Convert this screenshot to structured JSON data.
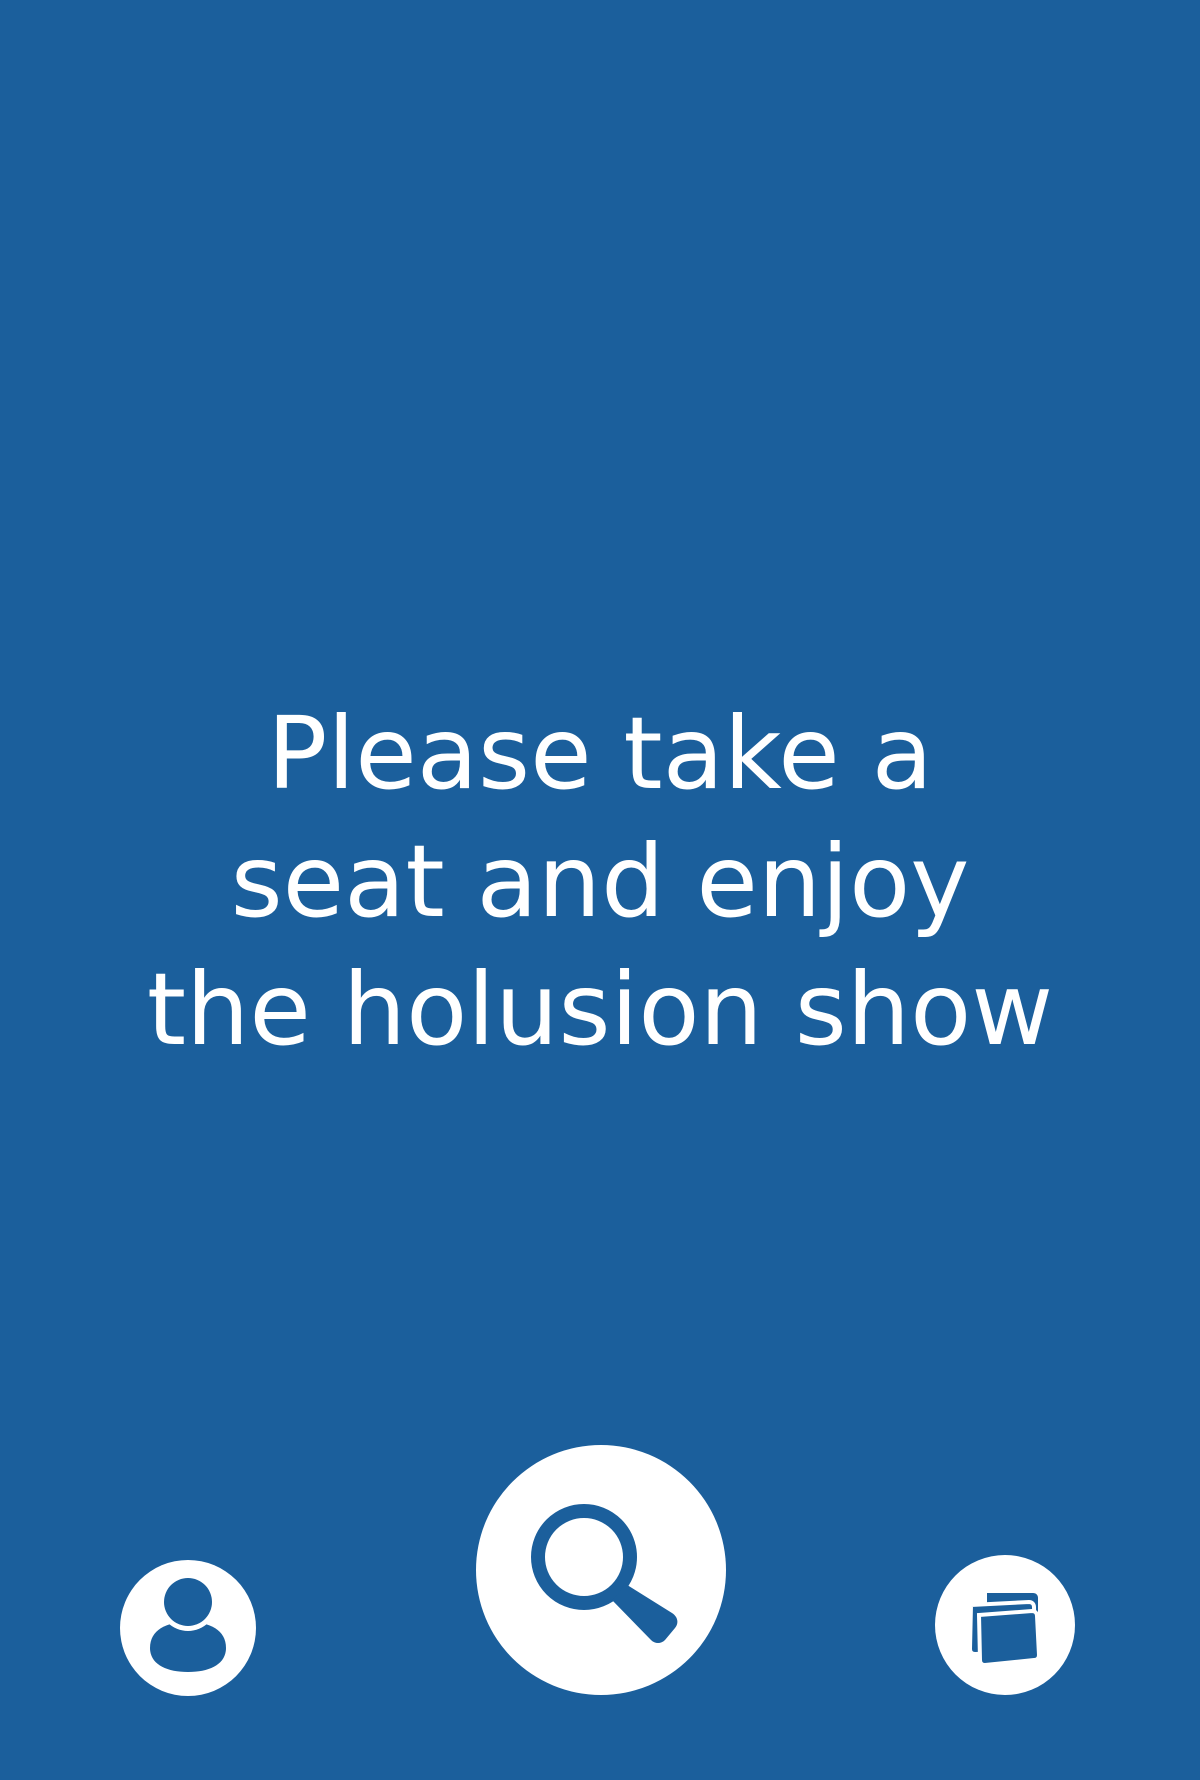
{
  "message": {
    "lines": [
      "Please take a",
      "seat and enjoy",
      "the holusion show"
    ]
  },
  "controls": {
    "profile": {
      "icon": "user-icon"
    },
    "search": {
      "icon": "magnifier-icon"
    },
    "gallery": {
      "icon": "cards-icon"
    }
  },
  "colors": {
    "background": "#1b5f9c",
    "foreground": "#ffffff"
  }
}
